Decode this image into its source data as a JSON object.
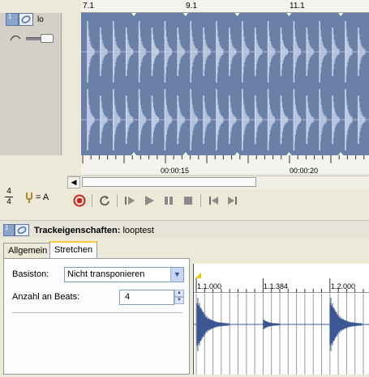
{
  "track": {
    "number": "1",
    "name_partial": "lo"
  },
  "timeline": {
    "bar_labels": [
      "7.1",
      "9.1",
      "11.1"
    ],
    "time_labels": [
      "00:00:15",
      "00:00:20"
    ]
  },
  "time_signature": {
    "numerator": "4",
    "denominator": "4"
  },
  "tuning": {
    "label": "= A"
  },
  "transport": {
    "buttons": [
      "record",
      "loop",
      "play-from-start",
      "play",
      "pause",
      "stop",
      "go-to-start",
      "go-to-end"
    ]
  },
  "properties": {
    "track_number": "1",
    "title_label": "Trackeigenschaften:",
    "title_value": "looptest"
  },
  "tabs": [
    {
      "label": "Allgemein",
      "active": false
    },
    {
      "label": "Stretchen",
      "active": true
    }
  ],
  "stretch": {
    "basiston_label": "Basiston:",
    "basiston_value": "Nicht transponieren",
    "beats_label": "Anzahl an Beats:",
    "beats_value": "4"
  },
  "loop_editor": {
    "ruler_labels": [
      "1.1.000",
      "1.1.384",
      "1.2.000"
    ]
  },
  "colors": {
    "waveform_bg": "#6b80a6",
    "waveform_fg": "#c8d4ec",
    "record": "#cc2222",
    "active_tab_accent": "#ffc83c"
  },
  "icons": {
    "record": "record-icon",
    "loop": "loop-icon",
    "play": "play-icon",
    "pause": "pause-icon",
    "stop": "stop-icon",
    "tuning_fork": "tuning-fork-icon"
  }
}
